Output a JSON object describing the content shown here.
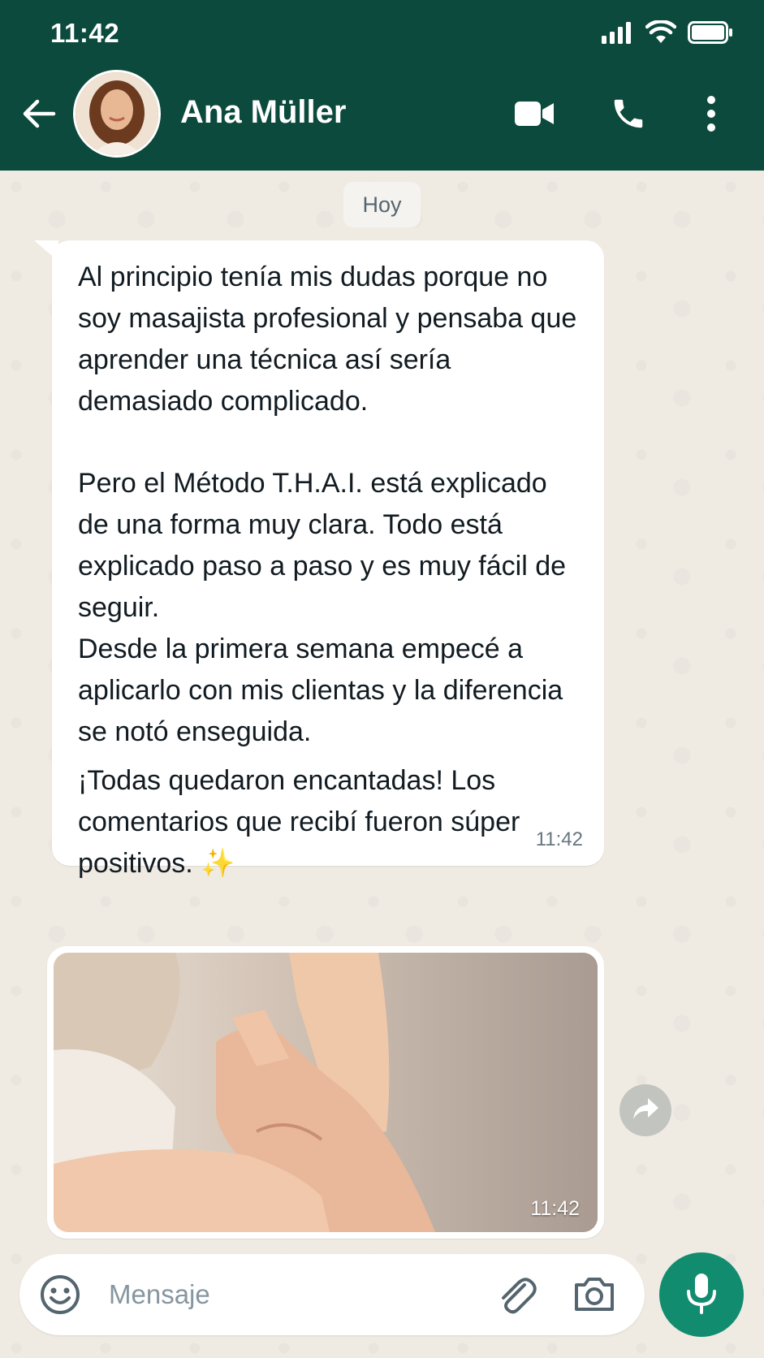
{
  "status_bar": {
    "time": "11:42"
  },
  "header": {
    "contact_name": "Ana Müller",
    "avatar_icon": "contact-photo"
  },
  "chat": {
    "date_chip": "Hoy",
    "message": {
      "paragraphs": [
        "Al principio tenía mis dudas porque no soy masajista profesional y pensaba que aprender una técnica así sería demasiado complicado.",
        "Pero el Método T.H.A.I. está explicado de una forma muy clara. Todo está explicado paso a paso y es muy fácil de seguir.",
        "Desde la primera semana empecé a aplicarlo con mis clientas y la diferencia se notó enseguida.",
        "¡Todas quedaron encantadas! Los comentarios que recibí fueron súper positivos. ✨"
      ],
      "time": "11:42"
    },
    "image_message": {
      "time": "11:42",
      "image_icon": "hand-massage-photo"
    }
  },
  "composer": {
    "placeholder": "Mensaje",
    "value": ""
  },
  "colors": {
    "header_bg": "#0b4a3c",
    "chat_bg": "#efeae2",
    "mic_button": "#128c6f"
  }
}
